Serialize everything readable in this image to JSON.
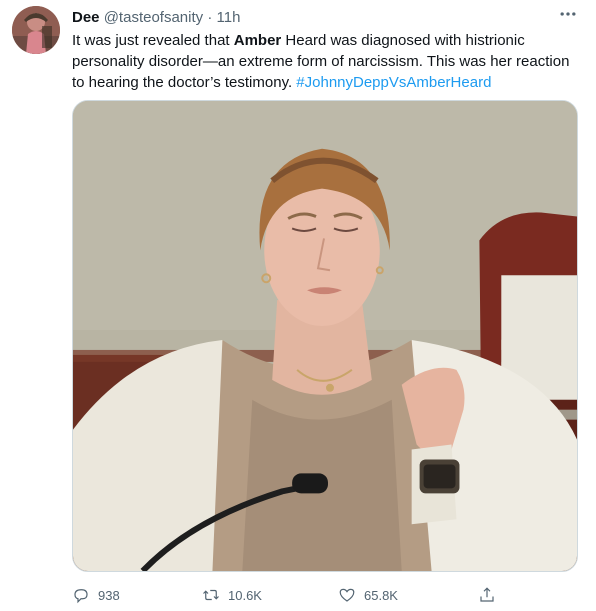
{
  "tweet": {
    "author_name": "Dee",
    "author_handle": "@tasteofsanity",
    "separator": "·",
    "time": "11h",
    "text_before_bold": "It was just revealed that ",
    "bold_text": "Amber",
    "text_after_bold": " Heard was diagnosed with histrionic personality disorder—an extreme form of narcissism. This was her reaction to hearing the doctor’s testimony. ",
    "hashtag": "#JohnnyDeppVsAmberHeard",
    "more_icon": "more-icon"
  },
  "actions": {
    "reply_count": "938",
    "retweet_count": "10.6K",
    "like_count": "65.8K"
  },
  "colors": {
    "link": "#1d9bf0",
    "secondary_text": "#536471",
    "primary_text": "#0f1419"
  }
}
